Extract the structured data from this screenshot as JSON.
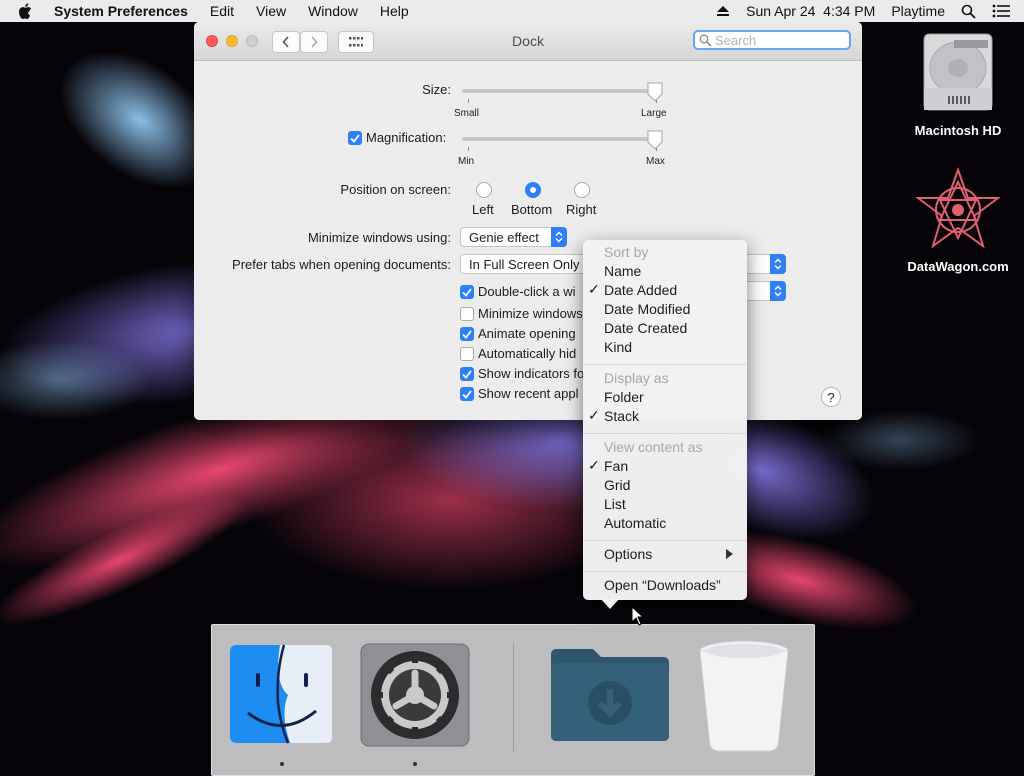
{
  "menubar": {
    "app_name": "System Preferences",
    "items": [
      "Edit",
      "View",
      "Window",
      "Help"
    ],
    "clock": "Sun Apr 24  4:34 PM",
    "user": "Playtime"
  },
  "desktop": {
    "icons": [
      {
        "label": "Macintosh HD"
      },
      {
        "label": "DataWagon.com"
      }
    ]
  },
  "window": {
    "title": "Dock",
    "search_placeholder": "Search",
    "size": {
      "label": "Size:",
      "min_label": "Small",
      "max_label": "Large",
      "value_fraction": 1.0
    },
    "magnification": {
      "label": "Magnification:",
      "checked": true,
      "min_label": "Min",
      "max_label": "Max",
      "value_fraction": 1.0
    },
    "position": {
      "label": "Position on screen:",
      "options": [
        "Left",
        "Bottom",
        "Right"
      ],
      "selected": "Bottom"
    },
    "minimize": {
      "label": "Minimize windows using:",
      "value": "Genie effect"
    },
    "prefer_tabs": {
      "label": "Prefer tabs when opening documents:",
      "value": "In Full Screen Only"
    },
    "checkboxes": [
      {
        "label": "Double-click a wi",
        "checked": true
      },
      {
        "label": "Minimize windows",
        "checked": false
      },
      {
        "label": "Animate opening",
        "checked": true
      },
      {
        "label": "Automatically hid",
        "checked": false
      },
      {
        "label": "Show indicators fo",
        "checked": true
      },
      {
        "label": "Show recent appl",
        "checked": true
      }
    ],
    "help_label": "?"
  },
  "context_menu": {
    "sort_by_header": "Sort by",
    "sort_items": [
      {
        "label": "Name",
        "checked": false
      },
      {
        "label": "Date Added",
        "checked": true
      },
      {
        "label": "Date Modified",
        "checked": false
      },
      {
        "label": "Date Created",
        "checked": false
      },
      {
        "label": "Kind",
        "checked": false
      }
    ],
    "display_header": "Display as",
    "display_items": [
      {
        "label": "Folder",
        "checked": false
      },
      {
        "label": "Stack",
        "checked": true
      }
    ],
    "view_header": "View content as",
    "view_items": [
      {
        "label": "Fan",
        "checked": true
      },
      {
        "label": "Grid",
        "checked": false
      },
      {
        "label": "List",
        "checked": false
      },
      {
        "label": "Automatic",
        "checked": false
      }
    ],
    "options_label": "Options",
    "open_label": "Open “Downloads”",
    "check_glyph": "✓"
  },
  "dock": {
    "items": [
      "Finder",
      "System Preferences",
      "Downloads",
      "Trash"
    ]
  },
  "colors": {
    "accent": "#2f7ff7",
    "menu_header": "#a7a7a7"
  }
}
